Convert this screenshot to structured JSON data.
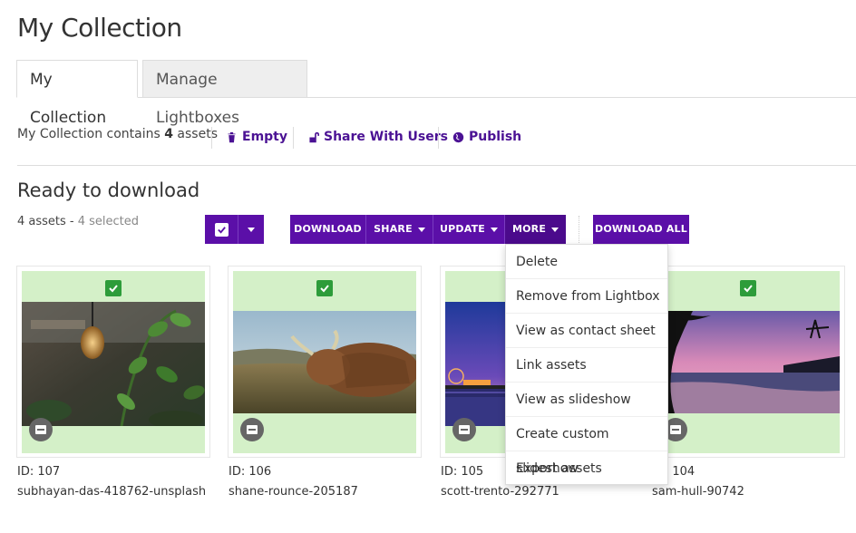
{
  "page": {
    "title": "My Collection"
  },
  "tabs": [
    {
      "label": "My Collection"
    },
    {
      "label": "Manage Lightboxes"
    }
  ],
  "info": {
    "prefix": "My Collection contains ",
    "count": "4",
    "suffix": " assets"
  },
  "actions": {
    "empty": "Empty",
    "share": "Share With Users",
    "publish": "Publish"
  },
  "section": {
    "title": "Ready to download",
    "assets_count": "4 assets - ",
    "selected": "4 selected"
  },
  "toolbar": {
    "download": "DOWNLOAD",
    "share": "SHARE",
    "update": "UPDATE",
    "more": "MORE",
    "download_all": "DOWNLOAD ALL"
  },
  "more_menu": [
    "Delete",
    "Remove from Lightbox",
    "View as contact sheet",
    "Link assets",
    "View as slideshow",
    "Create custom slideshow",
    "Export assets"
  ],
  "cards": [
    {
      "id": "ID: 107",
      "name": "subhayan-das-418762-unsplash"
    },
    {
      "id": "ID: 106",
      "name": "shane-rounce-205187"
    },
    {
      "id": "ID: 105",
      "name": "scott-trento-292771"
    },
    {
      "id": "ID: 104",
      "name": "sam-hull-90742"
    }
  ],
  "colors": {
    "brand": "#5b0fa8",
    "link": "#4b1294",
    "selected_bg": "#d4f0c8",
    "check": "#2d9c3a"
  }
}
